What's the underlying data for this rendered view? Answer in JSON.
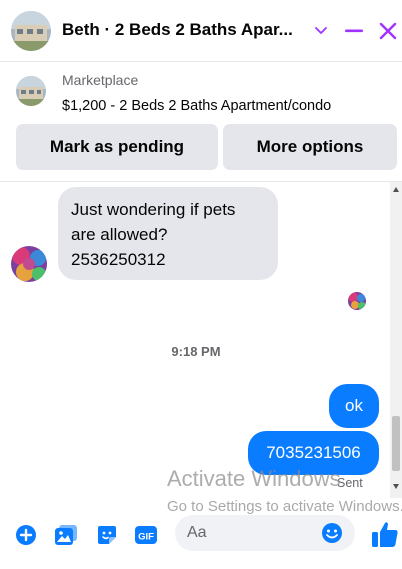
{
  "header": {
    "title": "Beth · 2 Beds 2 Baths Apar...",
    "chevron_icon": "chevron-down-icon",
    "minimize_icon": "minus-icon",
    "close_icon": "close-icon"
  },
  "marketplace": {
    "source": "Marketplace",
    "listing": "$1,200 - 2 Beds 2 Baths Apartment/condo",
    "mark_pending_label": "Mark as pending",
    "more_options_label": "More options"
  },
  "chat": {
    "incoming_message": {
      "lines": [
        "Just wondering if pets",
        "are allowed?",
        "2536250312"
      ]
    },
    "timestamp": "9:18 PM",
    "outgoing_messages": [
      "ok",
      "7035231506"
    ],
    "status": "Sent"
  },
  "composer": {
    "placeholder": "Aa",
    "icons": [
      "plus-circle-icon",
      "image-icon",
      "sticker-icon",
      "gif-icon",
      "emoji-icon",
      "thumbs-up-icon"
    ]
  },
  "watermark": {
    "title": "Activate Windows",
    "subtitle": "Go to Settings to activate Windows."
  },
  "colors": {
    "accent": "#0a7cff",
    "header_icons": "#a033ff",
    "bubble_in": "#e4e6eb",
    "muted_text": "#65676b"
  }
}
